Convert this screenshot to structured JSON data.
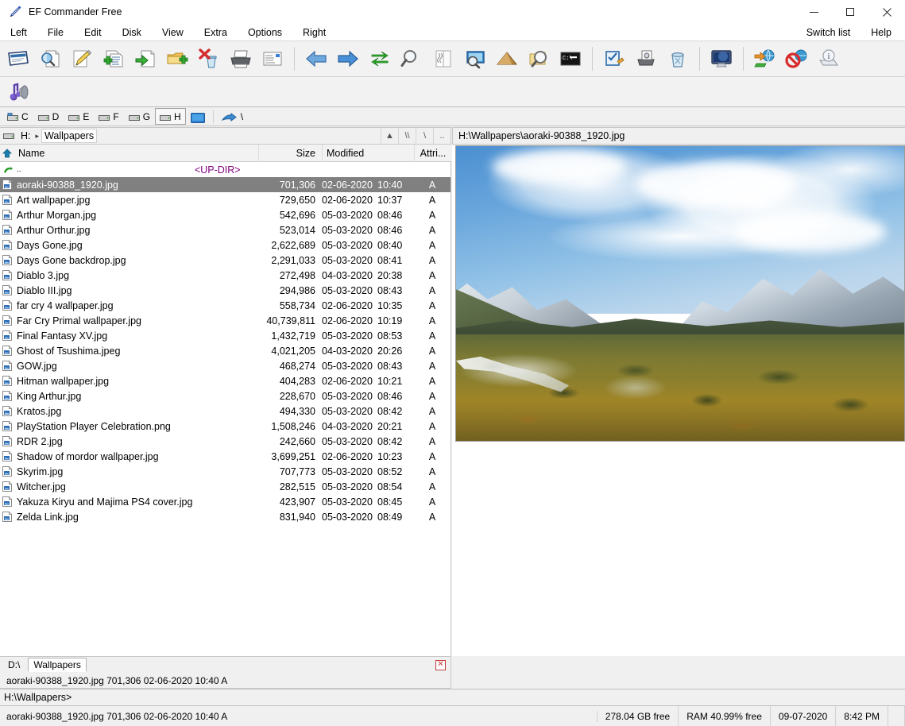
{
  "window": {
    "title": "EF Commander Free",
    "app_icon": "pen-icon",
    "minimize_label": "Minimize",
    "maximize_label": "Maximize",
    "close_label": "Close"
  },
  "menubar": {
    "items": [
      "Left",
      "File",
      "Edit",
      "Disk",
      "View",
      "Extra",
      "Options",
      "Right"
    ],
    "right_items": [
      "Switch list",
      "Help"
    ]
  },
  "toolbar": {
    "groups": [
      {
        "buttons": [
          {
            "name": "view-file-icon",
            "tip": "View"
          },
          {
            "name": "quick-view-icon",
            "tip": "Quick view"
          },
          {
            "name": "edit-file-icon",
            "tip": "Edit"
          },
          {
            "name": "copy-file-icon",
            "tip": "Copy"
          },
          {
            "name": "move-file-icon",
            "tip": "Move"
          },
          {
            "name": "new-folder-icon",
            "tip": "New folder"
          },
          {
            "name": "delete-icon",
            "tip": "Delete"
          },
          {
            "name": "print-icon",
            "tip": "Print"
          },
          {
            "name": "properties-icon",
            "tip": "Properties"
          }
        ]
      },
      {
        "buttons": [
          {
            "name": "back-arrow-icon",
            "tip": "Back"
          },
          {
            "name": "forward-arrow-icon",
            "tip": "Forward"
          },
          {
            "name": "refresh-icon",
            "tip": "Refresh"
          },
          {
            "name": "search-icon",
            "tip": "Search"
          },
          {
            "name": "compare-icon",
            "tip": "Compare"
          },
          {
            "name": "preview-icon",
            "tip": "Preview"
          },
          {
            "name": "ftp-upload-icon",
            "tip": "Upload"
          },
          {
            "name": "find-files-icon",
            "tip": "Find files"
          },
          {
            "name": "console-icon",
            "tip": "Command prompt"
          }
        ]
      },
      {
        "buttons": [
          {
            "name": "checklist-icon",
            "tip": "Multi rename"
          },
          {
            "name": "scanner-icon",
            "tip": "Scanner"
          },
          {
            "name": "recycle-bin-icon",
            "tip": "Recycle bin"
          }
        ]
      },
      {
        "buttons": [
          {
            "name": "monitor-icon",
            "tip": "Desktop"
          }
        ]
      },
      {
        "buttons": [
          {
            "name": "ftp-connect-icon",
            "tip": "FTP connect"
          },
          {
            "name": "ftp-disconnect-icon",
            "tip": "FTP disconnect"
          },
          {
            "name": "drive-info-icon",
            "tip": "Drive info"
          }
        ]
      }
    ],
    "row2": [
      {
        "name": "multimedia-icon",
        "tip": "Multimedia player"
      }
    ]
  },
  "drives": {
    "items": [
      {
        "letter": "C",
        "type": "hdd",
        "active": false
      },
      {
        "letter": "D",
        "type": "hdd",
        "active": false
      },
      {
        "letter": "E",
        "type": "hdd",
        "active": false
      },
      {
        "letter": "F",
        "type": "hdd",
        "active": false
      },
      {
        "letter": "G",
        "type": "hdd",
        "active": false
      },
      {
        "letter": "H",
        "type": "hdd",
        "active": true
      }
    ],
    "network_icon": "network-drive-icon",
    "unc_icon": "unc-path-icon",
    "unc_label": "\\"
  },
  "left_panel": {
    "path": {
      "drive_icon": "hdd-icon",
      "drive_label": "H:",
      "separator": "▸",
      "folder": "Wallpapers",
      "buttons": [
        {
          "name": "eject-button",
          "glyph": "▲"
        },
        {
          "name": "unc-button",
          "glyph": "\\\\"
        },
        {
          "name": "root-button",
          "glyph": "\\"
        },
        {
          "name": "updir-button",
          "glyph": ".."
        }
      ]
    },
    "columns": [
      {
        "key": "name",
        "label": "Name"
      },
      {
        "key": "size",
        "label": "Size"
      },
      {
        "key": "modified",
        "label": "Modified"
      },
      {
        "key": "attr",
        "label": "Attri..."
      }
    ],
    "sort_icon": "sort-ascending-icon",
    "parent_row": {
      "name": "..",
      "size": "<UP-DIR>",
      "date": "",
      "time": "",
      "attr": ""
    },
    "files": [
      {
        "name": "aoraki-90388_1920.jpg",
        "size": "701,306",
        "date": "02-06-2020",
        "time": "10:40",
        "attr": "A",
        "selected": true
      },
      {
        "name": "Art wallpaper.jpg",
        "size": "729,650",
        "date": "02-06-2020",
        "time": "10:37",
        "attr": "A",
        "selected": false
      },
      {
        "name": "Arthur Morgan.jpg",
        "size": "542,696",
        "date": "05-03-2020",
        "time": "08:46",
        "attr": "A",
        "selected": false
      },
      {
        "name": "Arthur Orthur.jpg",
        "size": "523,014",
        "date": "05-03-2020",
        "time": "08:46",
        "attr": "A",
        "selected": false
      },
      {
        "name": "Days Gone.jpg",
        "size": "2,622,689",
        "date": "05-03-2020",
        "time": "08:40",
        "attr": "A",
        "selected": false
      },
      {
        "name": "Days Gone backdrop.jpg",
        "size": "2,291,033",
        "date": "05-03-2020",
        "time": "08:41",
        "attr": "A",
        "selected": false
      },
      {
        "name": "Diablo 3.jpg",
        "size": "272,498",
        "date": "04-03-2020",
        "time": "20:38",
        "attr": "A",
        "selected": false
      },
      {
        "name": "Diablo III.jpg",
        "size": "294,986",
        "date": "05-03-2020",
        "time": "08:43",
        "attr": "A",
        "selected": false
      },
      {
        "name": "far cry 4 wallpaper.jpg",
        "size": "558,734",
        "date": "02-06-2020",
        "time": "10:35",
        "attr": "A",
        "selected": false
      },
      {
        "name": "Far Cry Primal wallpaper.jpg",
        "size": "40,739,811",
        "date": "02-06-2020",
        "time": "10:19",
        "attr": "A",
        "selected": false
      },
      {
        "name": "Final Fantasy XV.jpg",
        "size": "1,432,719",
        "date": "05-03-2020",
        "time": "08:53",
        "attr": "A",
        "selected": false
      },
      {
        "name": "Ghost of Tsushima.jpeg",
        "size": "4,021,205",
        "date": "04-03-2020",
        "time": "20:26",
        "attr": "A",
        "selected": false
      },
      {
        "name": "GOW.jpg",
        "size": "468,274",
        "date": "05-03-2020",
        "time": "08:43",
        "attr": "A",
        "selected": false
      },
      {
        "name": "Hitman wallpaper.jpg",
        "size": "404,283",
        "date": "02-06-2020",
        "time": "10:21",
        "attr": "A",
        "selected": false
      },
      {
        "name": "King Arthur.jpg",
        "size": "228,670",
        "date": "05-03-2020",
        "time": "08:46",
        "attr": "A",
        "selected": false
      },
      {
        "name": "Kratos.jpg",
        "size": "494,330",
        "date": "05-03-2020",
        "time": "08:42",
        "attr": "A",
        "selected": false
      },
      {
        "name": "PlayStation Player Celebration.png",
        "size": "1,508,246",
        "date": "04-03-2020",
        "time": "20:21",
        "attr": "A",
        "selected": false
      },
      {
        "name": "RDR 2.jpg",
        "size": "242,660",
        "date": "05-03-2020",
        "time": "08:42",
        "attr": "A",
        "selected": false
      },
      {
        "name": "Shadow of mordor wallpaper.jpg",
        "size": "3,699,251",
        "date": "02-06-2020",
        "time": "10:23",
        "attr": "A",
        "selected": false
      },
      {
        "name": "Skyrim.jpg",
        "size": "707,773",
        "date": "05-03-2020",
        "time": "08:52",
        "attr": "A",
        "selected": false
      },
      {
        "name": "Witcher.jpg",
        "size": "282,515",
        "date": "05-03-2020",
        "time": "08:54",
        "attr": "A",
        "selected": false
      },
      {
        "name": "Yakuza Kiryu and Majima PS4 cover.jpg",
        "size": "423,907",
        "date": "05-03-2020",
        "time": "08:45",
        "attr": "A",
        "selected": false
      },
      {
        "name": "Zelda Link.jpg",
        "size": "831,940",
        "date": "05-03-2020",
        "time": "08:49",
        "attr": "A",
        "selected": false
      }
    ],
    "tabs": {
      "items": [
        {
          "label": "D:\\",
          "active": false
        },
        {
          "label": "Wallpapers",
          "active": true
        }
      ],
      "close_glyph": "✕"
    },
    "status": "aoraki-90388_1920.jpg   701,306  02-06-2020  10:40  A"
  },
  "right_panel": {
    "path": "H:\\Wallpapers\\aoraki-90388_1920.jpg",
    "image_alt": "aoraki mountain landscape photo"
  },
  "command_line": {
    "prompt": "H:\\Wallpapers>",
    "value": ""
  },
  "statusbar": {
    "file_info": "aoraki-90388_1920.jpg   701,306  02-06-2020  10:40  A",
    "disk_free": "278.04 GB free",
    "ram_free": "RAM 40.99% free",
    "date": "09-07-2020",
    "time": "8:42 PM"
  },
  "colors": {
    "selection_bg": "#808080",
    "updir_text": "#800080",
    "toolbar_bg": "#f2f2f2",
    "panel_bg": "#f0f0f0",
    "accent_blue": "#3a7fd5"
  }
}
